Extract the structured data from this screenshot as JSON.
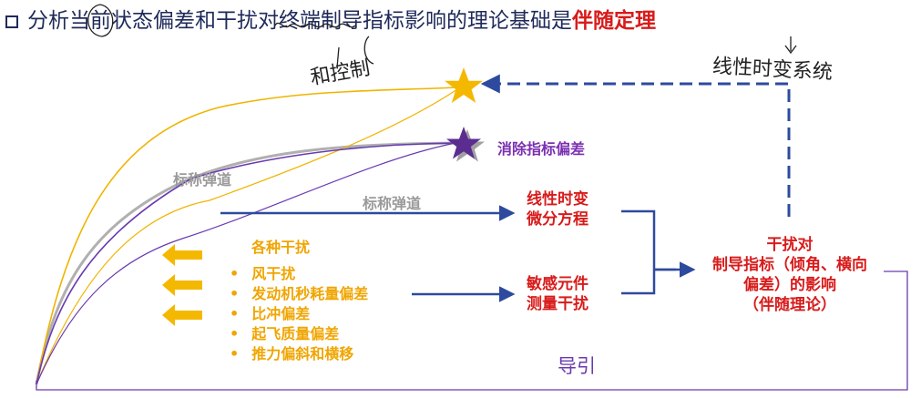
{
  "header": {
    "title_prefix": "分析当前状态偏差和干扰对终端制导指标影响的理论基础是",
    "title_emphasis": "伴随定理"
  },
  "annotations": {
    "handwritten_control": "和控制",
    "handwritten_ltv": "线性时变系统"
  },
  "diagram": {
    "target_label": "消除指标偏差",
    "nominal_trajectory_1": "标称弹道",
    "nominal_trajectory_2": "标称弹道",
    "ltv_box": [
      "线性时变",
      "微分方程"
    ],
    "sensor_box": [
      "敏感元件",
      "测量干扰"
    ],
    "disturbance_title": "各种干扰",
    "disturbances": [
      "风干扰",
      "发动机秒耗量偏差",
      "比冲偏差",
      "起飞质量偏差",
      "推力偏斜和横移"
    ],
    "result_box": [
      "干扰对",
      "制导指标（倾角、横向",
      "偏差）的影响",
      "（伴随理论）"
    ],
    "guidance_label": "导引"
  },
  "colors": {
    "title": "#1f2a5a",
    "emphasis": "#d81b1b",
    "arrow_blue": "#2e4a9e",
    "star_gold": "#f5b800",
    "star_purple": "#5b2d91",
    "curve_purple": "#6a3ab0",
    "curve_gray": "#b0b0b0",
    "curve_gold": "#f0b400",
    "arrow_gold": "#f5b800"
  }
}
